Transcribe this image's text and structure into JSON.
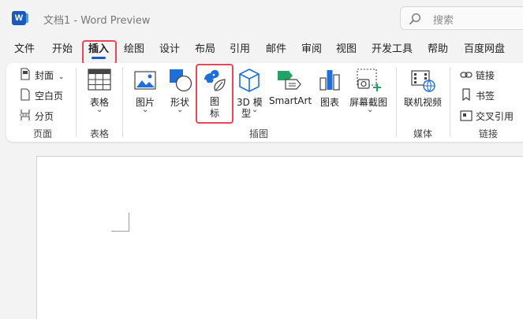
{
  "titlebar": {
    "doc_title": "文档1  -  Word Preview",
    "search_placeholder": "搜索"
  },
  "tabs": [
    {
      "label": "文件"
    },
    {
      "label": "开始"
    },
    {
      "label": "插入"
    },
    {
      "label": "绘图"
    },
    {
      "label": "设计"
    },
    {
      "label": "布局"
    },
    {
      "label": "引用"
    },
    {
      "label": "邮件"
    },
    {
      "label": "审阅"
    },
    {
      "label": "视图"
    },
    {
      "label": "开发工具"
    },
    {
      "label": "帮助"
    },
    {
      "label": "百度网盘"
    }
  ],
  "active_tab": "插入",
  "ribbon": {
    "pages": {
      "cover": "封面",
      "blank": "空白页",
      "break": "分页",
      "group": "页面"
    },
    "table": {
      "label": "表格",
      "group": "表格"
    },
    "illustrations": {
      "pictures": "图片",
      "shapes": "形状",
      "icons_line1": "图",
      "icons_line2": "标",
      "model_line1": "3D 模",
      "model_line2": "型",
      "smartart": "SmartArt",
      "chart": "图表",
      "screenshot": "屏幕截图",
      "group": "插图"
    },
    "media": {
      "online_video": "联机视频",
      "group": "媒体"
    },
    "links": {
      "link": "链接",
      "bookmark": "书签",
      "cross_ref": "交叉引用",
      "group": "链接"
    }
  },
  "colors": {
    "accent": "#185abd",
    "highlight": "#e8475a",
    "icon_blue": "#1e6fd9",
    "icon_green": "#21a366"
  }
}
